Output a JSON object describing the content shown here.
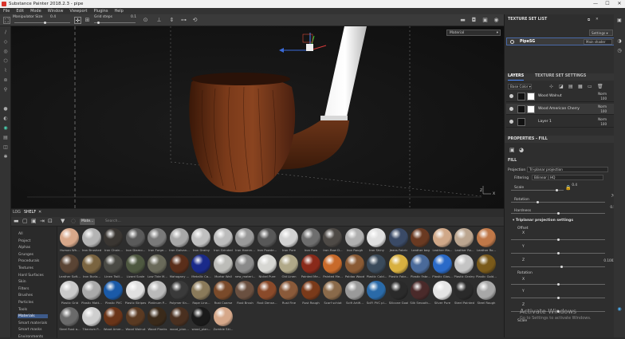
{
  "window": {
    "title": "Substance Painter 2018.2.3 - pipe",
    "minimize": "—",
    "maximize": "☐",
    "close": "✕"
  },
  "menu": [
    "File",
    "Edit",
    "Mode",
    "Window",
    "Viewport",
    "Plugins",
    "Help"
  ],
  "toolbar": {
    "manipulator_label": "Manipulator Size",
    "manipulator_value": "0.4",
    "manipulator_level": 0.55,
    "grid_label": "Grid steps",
    "grid_value": "0.1",
    "grid_level": 0.1
  },
  "viewport": {
    "material_mode": "Material",
    "axis_labels": [
      "Z",
      "X"
    ]
  },
  "shelf": {
    "tabs": [
      "LOG",
      "SHELF"
    ],
    "search_tag": "Mate...",
    "search_placeholder": "Search...",
    "categories": [
      "All",
      "Project",
      "Alphas",
      "Grunges",
      "Procedurals",
      "Textures",
      "Hard Surfaces",
      "Skin",
      "Filters",
      "Brushes",
      "Particles",
      "Tools",
      "Materials",
      "Smart materials",
      "Smart masks",
      "Environments"
    ],
    "active_category": "Materials",
    "materials": [
      {
        "name": "Human Wh...",
        "color": "#d8a88a"
      },
      {
        "name": "Iron Brushed",
        "color": "#b4b4b4"
      },
      {
        "name": "Iron Chain...",
        "color": "#3a3632"
      },
      {
        "name": "Iron Diamo...",
        "color": "#5a5a5a"
      },
      {
        "name": "Iron Forge...",
        "color": "#7a7a7a"
      },
      {
        "name": "Iron Galvan...",
        "color": "#a8a8a8"
      },
      {
        "name": "Iron Grainy",
        "color": "#c0c0c0"
      },
      {
        "name": "Iron Grinded",
        "color": "#bcbcbc"
      },
      {
        "name": "Iron Hamm...",
        "color": "#9a9a9a"
      },
      {
        "name": "Iron Powde...",
        "color": "#585858"
      },
      {
        "name": "Iron Pure",
        "color": "#d2d2d2"
      },
      {
        "name": "Iron Raw",
        "color": "#6e6e6e"
      },
      {
        "name": "Iron Raw D...",
        "color": "#4e4a46"
      },
      {
        "name": "Iron Rough",
        "color": "#b0b0b0"
      },
      {
        "name": "Iron Shiny",
        "color": "#e0e0e0"
      },
      {
        "name": "Jeans Fabric",
        "color": "#3a4a66"
      },
      {
        "name": "Leather bag",
        "color": "#6a3a22"
      },
      {
        "name": "Leather Ma...",
        "color": "#d0a888"
      },
      {
        "name": "Leather Ro...",
        "color": "#bca690"
      },
      {
        "name": "Leather Ro...",
        "color": "#c07848"
      },
      {
        "name": "Leather Soft...",
        "color": "#5a4434"
      },
      {
        "name": "Iron Burla...",
        "color": "#7a6440"
      },
      {
        "name": "Linen Twill...",
        "color": "#4a4a44"
      },
      {
        "name": "Lizard Scale",
        "color": "#4e5840"
      },
      {
        "name": "Low Tide M...",
        "color": "#6a6a5a"
      },
      {
        "name": "Mahogany ...",
        "color": "#5a2e1a"
      },
      {
        "name": "Metallic Ca...",
        "color": "#1a2a8a"
      },
      {
        "name": "Mortar Wall",
        "color": "#bcbcb8"
      },
      {
        "name": "new_materi...",
        "color": "#8a8a8a"
      },
      {
        "name": "Nickel Pure",
        "color": "#d6d6d2"
      },
      {
        "name": "Old Linen",
        "color": "#b0a888"
      },
      {
        "name": "Painted Me...",
        "color": "#8a2a1a"
      },
      {
        "name": "Painted Me...",
        "color": "#c86a2a"
      },
      {
        "name": "Paldao Wood",
        "color": "#8a5a34"
      },
      {
        "name": "Plastic Cold...",
        "color": "#3a4a5a"
      },
      {
        "name": "Plastic Fabr...",
        "color": "#d8b040"
      },
      {
        "name": "Plastic Fabr...",
        "color": "#4a6a9a"
      },
      {
        "name": "Plastic Glos...",
        "color": "#2a6ac8"
      },
      {
        "name": "Plastic Grainy",
        "color": "#c4c4c4"
      },
      {
        "name": "Plastic Gold...",
        "color": "#7a5a1a"
      },
      {
        "name": "Plastic Grid",
        "color": "#cacaca"
      },
      {
        "name": "Plastic Matt...",
        "color": "#aaaaaa"
      },
      {
        "name": "Plastic PVC",
        "color": "#1a5aa8"
      },
      {
        "name": "Plastic Stripes",
        "color": "#e0e0e0"
      },
      {
        "name": "Platinum P...",
        "color": "#bababa"
      },
      {
        "name": "Polymer Kn...",
        "color": "#3a3a3a"
      },
      {
        "name": "Rope Line...",
        "color": "#8a7a5a"
      },
      {
        "name": "Rust Coarse",
        "color": "#7a4a2a"
      },
      {
        "name": "Rust Brush",
        "color": "#6a5040"
      },
      {
        "name": "Rust Dense...",
        "color": "#8a4a2a"
      },
      {
        "name": "Rust Fine",
        "color": "#8a5a3a"
      },
      {
        "name": "Rust Rough",
        "color": "#7a3a1a"
      },
      {
        "name": "Scarf schiot",
        "color": "#8a6a4a"
      },
      {
        "name": "Scifi Artifi...",
        "color": "#9a9a9a"
      },
      {
        "name": "SciFi PVC pl...",
        "color": "#2a6aa8"
      },
      {
        "name": "Silicone Goal",
        "color": "#2a2a2a"
      },
      {
        "name": "Silk Smooth...",
        "color": "#4a2a2a"
      },
      {
        "name": "Silver Pure",
        "color": "#e4e4e4"
      },
      {
        "name": "Steel Painted",
        "color": "#2a2a2a"
      },
      {
        "name": "Steel Rough",
        "color": "#a8a8a8"
      },
      {
        "name": "Steel Rust a...",
        "color": "#6a6a6a"
      },
      {
        "name": "Titanium P...",
        "color": "#cfcfcf"
      },
      {
        "name": "Wood Amer...",
        "color": "#6a3418"
      },
      {
        "name": "Wood Walnut",
        "color": "#5a3a22"
      },
      {
        "name": "Wood Planks",
        "color": "#3a2a1a"
      },
      {
        "name": "wood_plan...",
        "color": "#4a3020"
      },
      {
        "name": "wood_plan...",
        "color": "#1a1a1a"
      },
      {
        "name": "Zombie Ski...",
        "color": "#d6a88a"
      }
    ]
  },
  "texture_set_list": {
    "title": "TEXTURE SET LIST",
    "settings": "Settings",
    "item": "PipeSG",
    "shader": "Main shader"
  },
  "layers": {
    "tabs": [
      "LAYERS",
      "TEXTURE SET SETTINGS"
    ],
    "channel": "Base Color",
    "items": [
      {
        "name": "Wood Walnut",
        "blend": "Norm",
        "opacity": "100"
      },
      {
        "name": "Wood American Cherry",
        "blend": "Norm",
        "opacity": "100"
      },
      {
        "name": "Layer 1",
        "blend": "Norm",
        "opacity": "100"
      }
    ]
  },
  "properties": {
    "title": "PROPERTIES - FILL",
    "section": "FILL",
    "projection_label": "Projection",
    "projection_value": "Tri-planar projection",
    "filtering_label": "Filtering",
    "filtering_value": "Bilinear | HQ",
    "scale_label": "Scale",
    "scale_value": "0.4",
    "rotation_label": "Rotation",
    "rotation_value": "79",
    "hardness_label": "Hardness",
    "hardness_value": "0.5",
    "triplanar_title": "Triplanar projection settings",
    "offset_label": "Offset",
    "offset_x": "X",
    "offset_y": "Y",
    "offset_z": "Z",
    "offset_z_value": "0.1002",
    "rotation2_label": "Rotation",
    "rot_x": "X",
    "rot_y": "Y",
    "rot_z": "Z",
    "scale2_label": "Scale"
  },
  "watermark": {
    "line1": "Activate Windows",
    "line2": "Go to Settings to activate Windows."
  }
}
